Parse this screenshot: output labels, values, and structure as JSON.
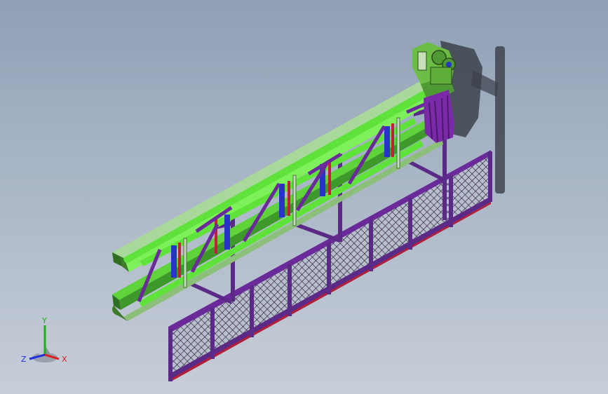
{
  "view": {
    "triad": {
      "x_label": "X",
      "y_label": "Y",
      "z_label": "Z",
      "x_color": "#e02020",
      "y_color": "#19b319",
      "z_color": "#2030e0"
    },
    "model": {
      "rail_color": "#5fe33a",
      "rail_dark": "#3d9a2a",
      "frame_color": "#6a2a9a",
      "post_color": "#5b2a86",
      "accent_red": "#c0203a",
      "accent_blue": "#2a33c8",
      "mesh_color": "#2a1a3a",
      "motor_color": "#7a2aa8",
      "housing_color": "#6bbd46"
    }
  }
}
